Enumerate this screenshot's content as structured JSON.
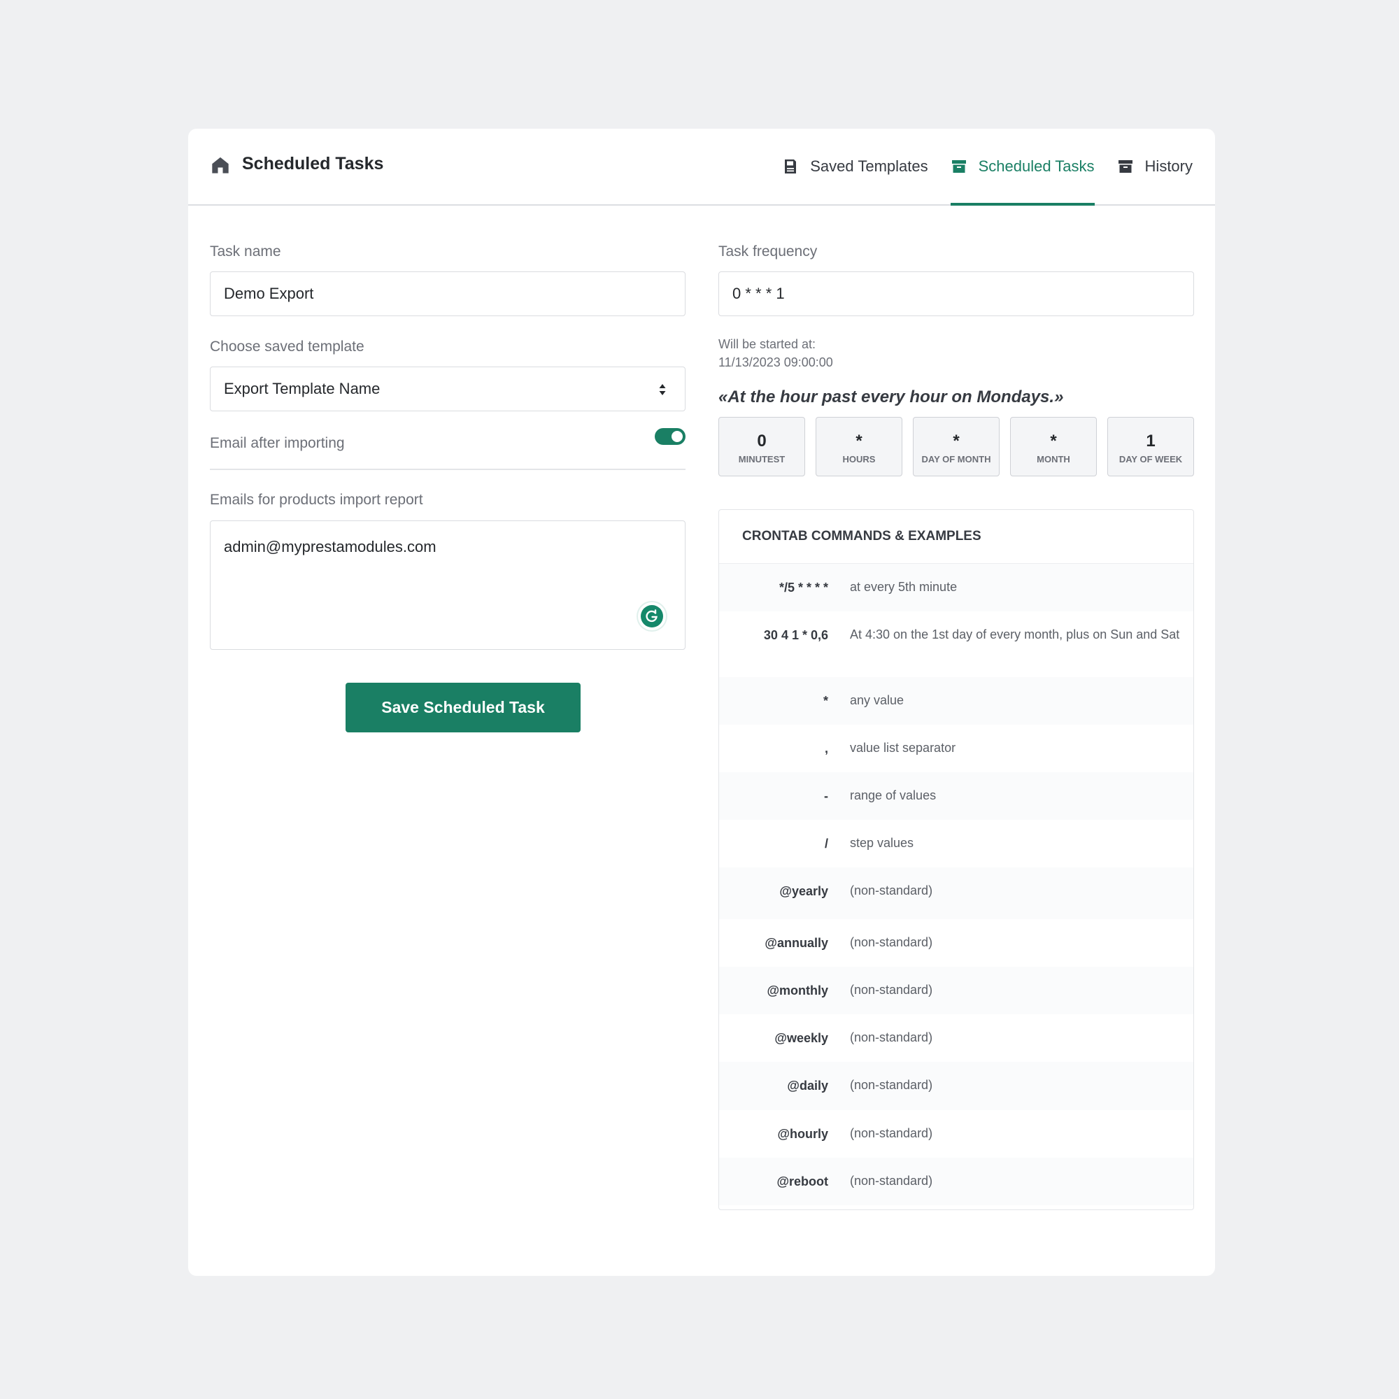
{
  "header": {
    "title": "Scheduled Tasks",
    "tabs": [
      {
        "label": "Saved Templates",
        "icon": "save-icon",
        "active": false
      },
      {
        "label": "Scheduled Tasks",
        "icon": "archive-icon",
        "active": true
      },
      {
        "label": "History",
        "icon": "archive-icon",
        "active": false
      }
    ]
  },
  "form": {
    "task_name_label": "Task name",
    "task_name_value": "Demo Export",
    "template_label": "Choose saved template",
    "template_value": "Export Template Name",
    "email_toggle_label": "Email after importing",
    "email_toggle_on": true,
    "emails_label": "Emails for products import report",
    "emails_value": "admin@myprestamodules.com",
    "save_label": "Save Scheduled Task"
  },
  "frequency": {
    "label": "Task frequency",
    "value": "0 * * * 1",
    "start_label": "Will be started at:",
    "start_value": "11/13/2023 09:00:00",
    "description": "«At the hour past every hour on Mondays.»",
    "fields": [
      {
        "value": "0",
        "unit": "MINUTEST"
      },
      {
        "value": "*",
        "unit": "HOURS"
      },
      {
        "value": "*",
        "unit": "DAY OF MONTH"
      },
      {
        "value": "*",
        "unit": "MONTH"
      },
      {
        "value": "1",
        "unit": "DAY OF WEEK"
      }
    ]
  },
  "examples": {
    "title": "CRONTAB COMMANDS & EXAMPLES",
    "rows": [
      {
        "code": "*/5 * * * *",
        "desc": "at every 5th minute"
      },
      {
        "code": "30 4 1 * 0,6",
        "desc": "At 4:30 on the 1st day of every month, plus on Sun and Sat"
      },
      {
        "code": "*",
        "desc": "any value"
      },
      {
        "code": ",",
        "desc": "value list separator"
      },
      {
        "code": "-",
        "desc": "range of values"
      },
      {
        "code": "/",
        "desc": "step values"
      },
      {
        "code": "@yearly",
        "desc": "(non-standard)"
      },
      {
        "code": "@annually",
        "desc": "(non-standard)"
      },
      {
        "code": "@monthly",
        "desc": "(non-standard)"
      },
      {
        "code": "@weekly",
        "desc": "(non-standard)"
      },
      {
        "code": "@daily",
        "desc": "(non-standard)"
      },
      {
        "code": "@hourly",
        "desc": "(non-standard)"
      },
      {
        "code": "@reboot",
        "desc": "(non-standard)"
      }
    ]
  },
  "colors": {
    "accent": "#1a7f64",
    "background": "#eff0f2"
  }
}
